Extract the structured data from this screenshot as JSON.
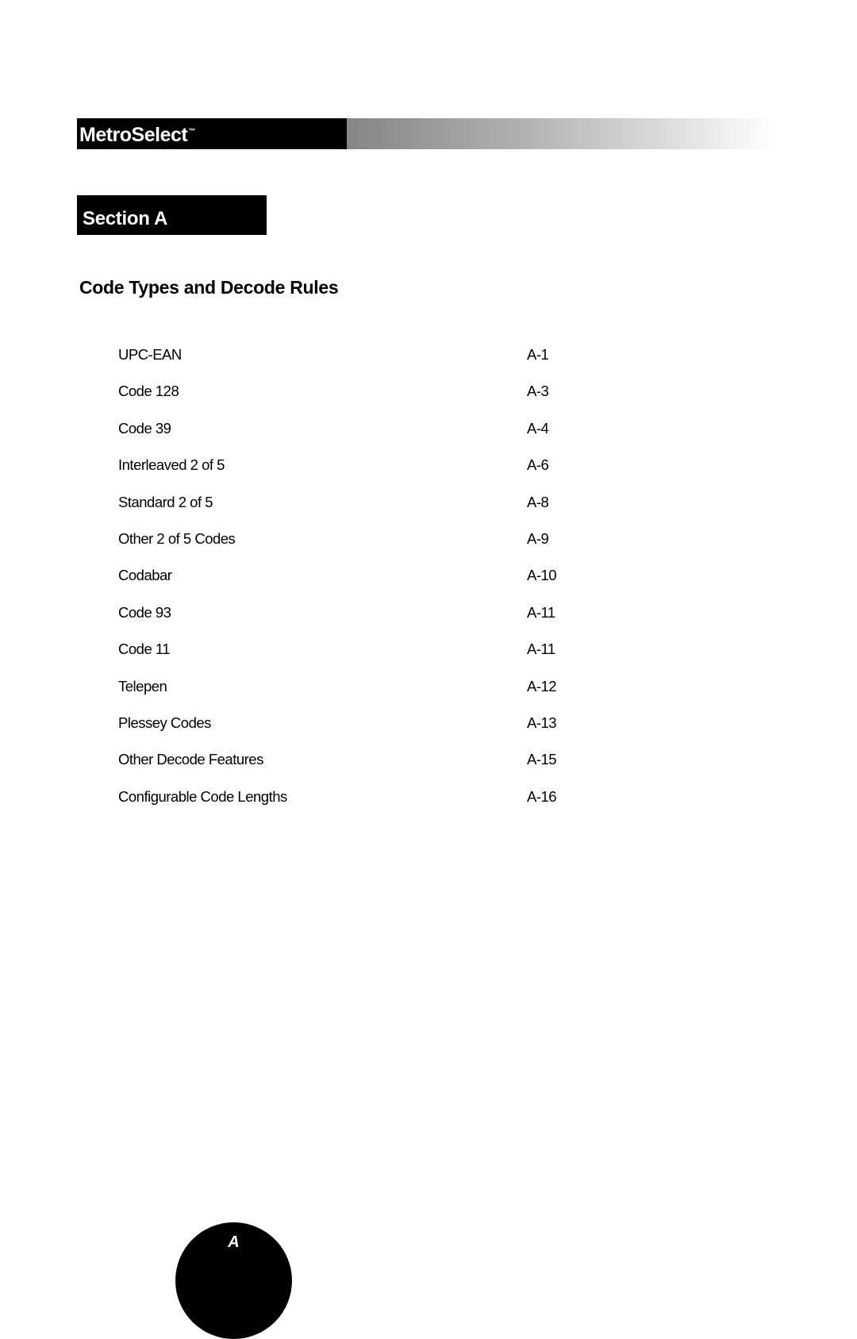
{
  "header": {
    "brand": "MetroSelect",
    "trademark": "™"
  },
  "section": {
    "label": "Section A"
  },
  "page_title": "Code Types and Decode Rules",
  "toc": [
    {
      "label": "UPC-EAN",
      "page": "A-1"
    },
    {
      "label": "Code 128",
      "page": "A-3"
    },
    {
      "label": "Code 39",
      "page": "A-4"
    },
    {
      "label": "Interleaved 2 of 5",
      "page": "A-6"
    },
    {
      "label": "Standard 2 of 5",
      "page": "A-8"
    },
    {
      "label": "Other 2 of 5 Codes",
      "page": "A-9"
    },
    {
      "label": "Codabar",
      "page": "A-10"
    },
    {
      "label": "Code 93",
      "page": "A-11"
    },
    {
      "label": "Code 11",
      "page": "A-11"
    },
    {
      "label": "Telepen",
      "page": "A-12"
    },
    {
      "label": "Plessey Codes",
      "page": "A-13"
    },
    {
      "label": "Other Decode Features",
      "page": "A-15"
    },
    {
      "label": "Configurable Code Lengths",
      "page": "A-16"
    }
  ],
  "footer": {
    "tab_letter": "A"
  }
}
